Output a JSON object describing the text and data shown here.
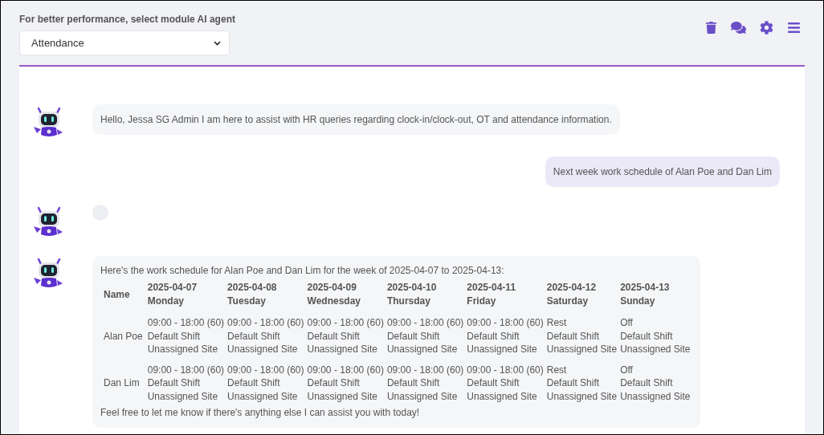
{
  "header": {
    "label": "For better performance, select module AI agent",
    "module_select": {
      "value": "Attendance"
    }
  },
  "messages": [
    {
      "kind": "bot-text",
      "text": "Hello, Jessa SG Admin I am here to assist with HR queries regarding clock-in/clock-out, OT and attendance information."
    },
    {
      "kind": "user-text",
      "text": "Next week work schedule of Alan Poe and Dan Lim"
    },
    {
      "kind": "bot-empty"
    },
    {
      "kind": "bot-table",
      "intro": "Here's the work schedule for Alan Poe and Dan Lim for the week of 2025-04-07 to 2025-04-13:",
      "outro": "Feel free to let me know if there's anything else I can assist you with today!",
      "table": {
        "name_header": "Name",
        "columns": [
          {
            "date": "2025-04-07",
            "day": "Monday"
          },
          {
            "date": "2025-04-08",
            "day": "Tuesday"
          },
          {
            "date": "2025-04-09",
            "day": "Wednesday"
          },
          {
            "date": "2025-04-10",
            "day": "Thursday"
          },
          {
            "date": "2025-04-11",
            "day": "Friday"
          },
          {
            "date": "2025-04-12",
            "day": "Saturday"
          },
          {
            "date": "2025-04-13",
            "day": "Sunday"
          }
        ],
        "rows": [
          {
            "name": "Alan Poe",
            "cells": [
              [
                "09:00 - 18:00 (60)",
                "Default Shift",
                "Unassigned Site"
              ],
              [
                "09:00 - 18:00 (60)",
                "Default Shift",
                "Unassigned Site"
              ],
              [
                "09:00 - 18:00 (60)",
                "Default Shift",
                "Unassigned Site"
              ],
              [
                "09:00 - 18:00 (60)",
                "Default Shift",
                "Unassigned Site"
              ],
              [
                "09:00 - 18:00 (60)",
                "Default Shift",
                "Unassigned Site"
              ],
              [
                "Rest",
                "Default Shift",
                "Unassigned Site"
              ],
              [
                "Off",
                "Default Shift",
                "Unassigned Site"
              ]
            ]
          },
          {
            "name": "Dan Lim",
            "cells": [
              [
                "09:00 - 18:00 (60)",
                "Default Shift",
                "Unassigned Site"
              ],
              [
                "09:00 - 18:00 (60)",
                "Default Shift",
                "Unassigned Site"
              ],
              [
                "09:00 - 18:00 (60)",
                "Default Shift",
                "Unassigned Site"
              ],
              [
                "09:00 - 18:00 (60)",
                "Default Shift",
                "Unassigned Site"
              ],
              [
                "09:00 - 18:00 (60)",
                "Default Shift",
                "Unassigned Site"
              ],
              [
                "Rest",
                "Default Shift",
                "Unassigned Site"
              ],
              [
                "Off",
                "Default Shift",
                "Unassigned Site"
              ]
            ]
          }
        ]
      }
    }
  ]
}
